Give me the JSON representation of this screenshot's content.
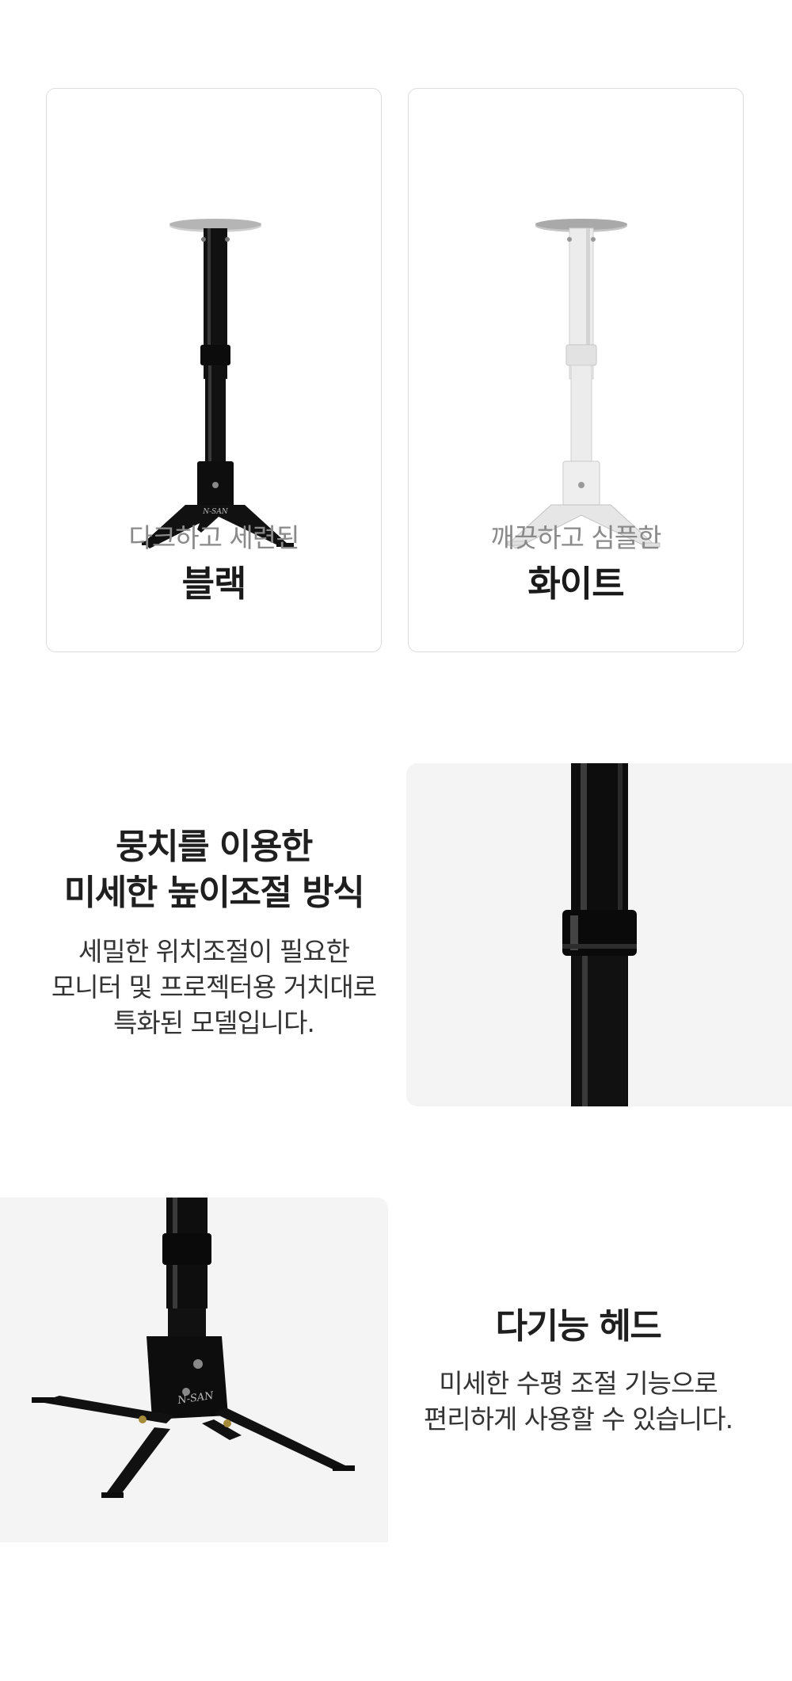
{
  "variants": [
    {
      "subtitle": "다크하고 세련된",
      "name": "블랙",
      "color": "#111111",
      "base_color": "#c9c9c9"
    },
    {
      "subtitle": "깨끗하고 심플한",
      "name": "화이트",
      "color": "#ededed",
      "base_color": "#b8b8b8"
    }
  ],
  "height_section": {
    "headline_line1": "뭉치를 이용한",
    "headline_line2": "미세한 높이조절 방식",
    "body_line1": "세밀한 위치조절이 필요한",
    "body_line2": "모니터 및 프로젝터용 거치대로",
    "body_line3": "특화된 모델입니다."
  },
  "head_section": {
    "headline": "다기능 헤드",
    "body_line1": "미세한 수평 조절 기능으로",
    "body_line2": "편리하게 사용할 수 있습니다."
  },
  "brand_mark": "N-SAN"
}
